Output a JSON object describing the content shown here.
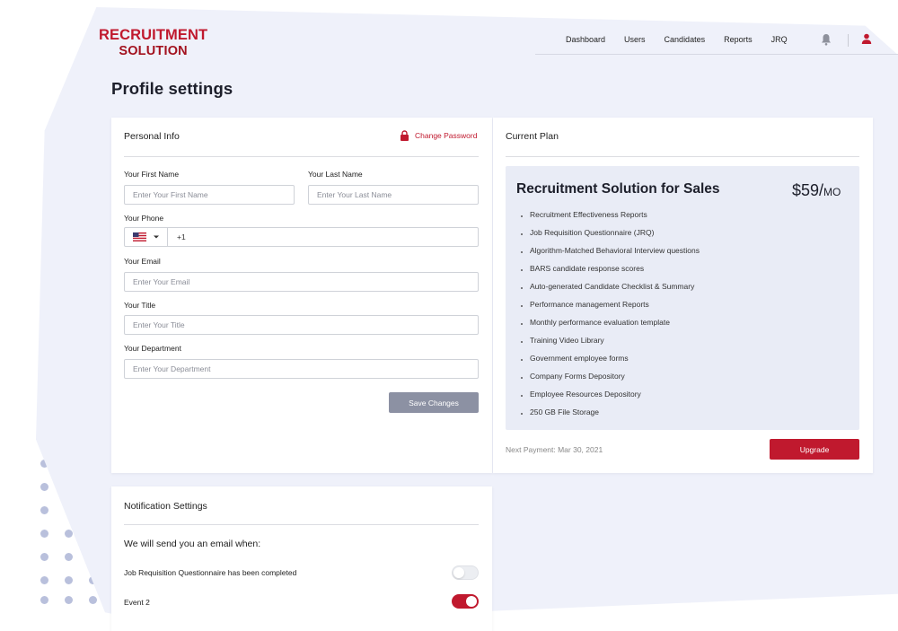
{
  "brand": {
    "line1": "RECRUITMENT",
    "line2": "SOLUTION"
  },
  "nav": {
    "items": [
      "Dashboard",
      "Users",
      "Candidates",
      "Reports",
      "JRQ"
    ]
  },
  "page": {
    "title": "Profile settings"
  },
  "personal": {
    "heading": "Personal Info",
    "change_password": "Change Password",
    "first_name": {
      "label": "Your First Name",
      "placeholder": "Enter Your First Name"
    },
    "last_name": {
      "label": "Your Last Name",
      "placeholder": "Enter Your Last Name"
    },
    "phone": {
      "label": "Your Phone",
      "country": "US",
      "code": "+1"
    },
    "email": {
      "label": "Your Email",
      "placeholder": "Enter Your Email"
    },
    "title": {
      "label": "Your Title",
      "placeholder": "Enter Your Title"
    },
    "department": {
      "label": "Your Department",
      "placeholder": "Enter Your Department"
    },
    "save": "Save Changes"
  },
  "plan": {
    "heading": "Current Plan",
    "name": "Recruitment Solution for Sales",
    "price": "$59/",
    "period": "MO",
    "features": [
      "Recruitment Effectiveness Reports",
      "Job Requisition Questionnaire (JRQ)",
      "Algorithm-Matched Behavioral Interview questions",
      "BARS candidate response scores",
      "Auto-generated Candidate Checklist & Summary",
      "Performance management Reports",
      "Monthly performance evaluation template",
      "Training Video Library",
      "Government employee forms",
      "Company Forms Depository",
      "Employee Resources Depository",
      "250 GB File Storage"
    ],
    "next_payment": "Next Payment: Mar 30, 2021",
    "upgrade": "Upgrade"
  },
  "notifications": {
    "heading": "Notification Settings",
    "intro": "We will send you an email when:",
    "items": [
      {
        "label": "Job Requisition Questionnaire has been completed",
        "enabled": false
      },
      {
        "label": "Event 2",
        "enabled": true
      }
    ]
  },
  "colors": {
    "accent": "#c0192e",
    "background": "#eff1fa"
  }
}
